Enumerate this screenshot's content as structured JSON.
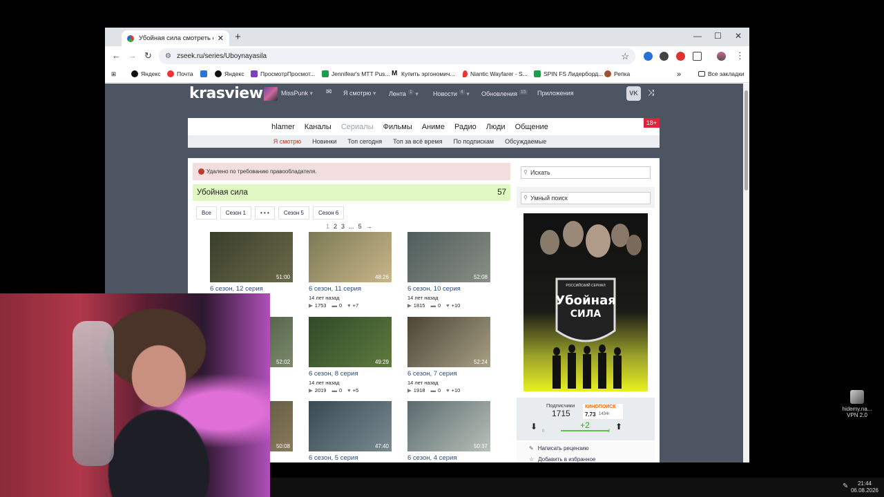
{
  "browser": {
    "tab_title": "Убойная сила смотреть онлай",
    "url": "zseek.ru/series/Uboynayasila",
    "bookmarks": [
      {
        "label": "Яндекс",
        "color": "#111"
      },
      {
        "label": "Почта",
        "color": "#e33"
      },
      {
        "label": "VK",
        "color": "#2a76d4"
      },
      {
        "label": "Яндекс",
        "color": "#111"
      },
      {
        "label": "ПросмотрПросмот...",
        "color": "#7b3fbf"
      },
      {
        "label": "Jennifear's MTT Pus...",
        "color": "#1e9e4b"
      },
      {
        "label": "Купить эргономич...",
        "color": "#111"
      },
      {
        "label": "Niantic Wayfarer - S...",
        "color": "#e33"
      },
      {
        "label": "SPIN FS Лидерборд...",
        "color": "#1e9e4b"
      },
      {
        "label": "Репка",
        "color": "#a0522d"
      }
    ],
    "all_bookmarks": "Все закладки"
  },
  "site": {
    "logo": "krasview",
    "user": "MissPunk",
    "header_items": [
      {
        "label": "Я смотрю",
        "badge": ""
      },
      {
        "label": "Лента",
        "badge": "1"
      },
      {
        "label": "Новости",
        "badge": "4"
      },
      {
        "label": "Обновления",
        "badge": "15"
      },
      {
        "label": "Приложения",
        "badge": ""
      }
    ],
    "vk": "VK",
    "categories": [
      "hlamer",
      "Каналы",
      "Сериалы",
      "Фильмы",
      "Аниме",
      "Радио",
      "Люди",
      "Общение"
    ],
    "active_category": "Сериалы",
    "subnav": [
      "Я смотрю",
      "Новинки",
      "Топ сегодня",
      "Топ за всё время",
      "По подпискам",
      "Обсуждаемые"
    ],
    "age": "18+"
  },
  "main": {
    "alert": "Удалено по требованию правообладателя.",
    "series_title": "Убойная сила",
    "series_count": "57",
    "seasons": [
      "Все",
      "Сезон 1",
      "• • •",
      "Сезон 5",
      "Сезон 6"
    ],
    "pages": [
      "1",
      "2",
      "3",
      "...",
      "5",
      "→"
    ],
    "episodes": [
      {
        "title": "6 сезон, 12 серия",
        "duration": "51:00",
        "date": "",
        "views": "",
        "comments": "",
        "likes": "",
        "colors": [
          "#3a3f2a",
          "#6a6a4a"
        ]
      },
      {
        "title": "6 сезон, 11 серия",
        "duration": "48:26",
        "date": "14 лет назад",
        "views": "1753",
        "comments": "0",
        "likes": "+7",
        "colors": [
          "#7b7a55",
          "#c9b58a"
        ]
      },
      {
        "title": "6 сезон, 10 серия",
        "duration": "52:08",
        "date": "14 лет назад",
        "views": "1815",
        "comments": "0",
        "likes": "+10",
        "colors": [
          "#4e5c5a",
          "#8a8f86"
        ]
      },
      {
        "title": "",
        "duration": "52:02",
        "date": "",
        "views": "",
        "comments": "",
        "likes": "",
        "colors": [
          "#3b4a35",
          "#7a8a6a"
        ]
      },
      {
        "title": "6 сезон, 8 серия",
        "duration": "49:29",
        "date": "14 лет назад",
        "views": "2019",
        "comments": "0",
        "likes": "+5",
        "colors": [
          "#2f4a28",
          "#5f7a3e"
        ]
      },
      {
        "title": "6 сезон, 7 серия",
        "duration": "52:24",
        "date": "14 лет назад",
        "views": "1918",
        "comments": "0",
        "likes": "+10",
        "colors": [
          "#4a4535",
          "#a89f85"
        ]
      },
      {
        "title": "",
        "duration": "50:08",
        "date": "",
        "views": "",
        "comments": "",
        "likes": "",
        "colors": [
          "#4a4a3a",
          "#8a7a5a"
        ]
      },
      {
        "title": "6 сезон, 5 серия",
        "duration": "47:40",
        "date": "",
        "views": "",
        "comments": "",
        "likes": "",
        "colors": [
          "#3a4a55",
          "#7a8a90"
        ]
      },
      {
        "title": "6 сезон, 4 серия",
        "duration": "50:37",
        "date": "",
        "views": "",
        "comments": "",
        "likes": "",
        "colors": [
          "#5a6a6e",
          "#b8c0b8"
        ]
      }
    ]
  },
  "sidebar": {
    "search_placeholder": "Искать",
    "smart_search_placeholder": "Умный поиск",
    "poster_small": "РОССИЙСКИЙ СЕРИАЛ",
    "poster_title_1": "Убойная",
    "poster_title_2": "СИЛА",
    "subscribers_label": "Подписчики",
    "subscribers": "1715",
    "kp_label": "КИНОПОИСК",
    "kp_rating": "7.73",
    "kp_votes": "1434г",
    "rating": "+2",
    "rating_min": "0",
    "rating_max": "2",
    "write_review": "Написать рецензию",
    "add_favorite": "Добавить в избранное"
  },
  "desktop": {
    "vpn_label_1": "hidemy.na...",
    "vpn_label_2": "VPN 2.0",
    "time": "21:44",
    "date": "06.08.2026"
  }
}
